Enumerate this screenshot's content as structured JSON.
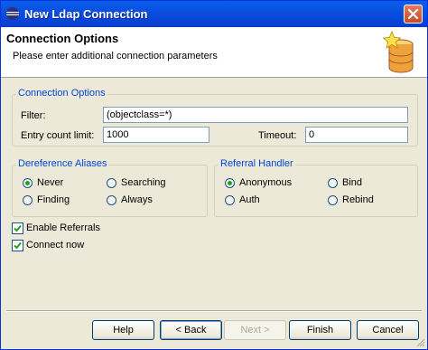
{
  "window": {
    "title": "New Ldap Connection"
  },
  "banner": {
    "title": "Connection Options",
    "description": "Please enter additional connection parameters"
  },
  "connection_options": {
    "legend": "Connection Options",
    "filter_label": "Filter:",
    "filter_value": "(objectclass=*)",
    "count_limit_label": "Entry count limit:",
    "count_limit_value": "1000",
    "timeout_label": "Timeout:",
    "timeout_value": "0"
  },
  "dereference": {
    "legend": "Dereference Aliases",
    "options": [
      "Never",
      "Searching",
      "Finding",
      "Always"
    ],
    "selected": "Never"
  },
  "referral": {
    "legend": "Referral Handler",
    "options": [
      "Anonymous",
      "Bind",
      "Auth",
      "Rebind"
    ],
    "selected": "Anonymous"
  },
  "checkboxes": {
    "enable_referrals": {
      "label": "Enable Referrals",
      "checked": true
    },
    "connect_now": {
      "label": "Connect now",
      "checked": true
    }
  },
  "buttons": {
    "help": "Help",
    "back": "< Back",
    "next": "Next >",
    "finish": "Finish",
    "cancel": "Cancel"
  },
  "colors": {
    "title_bar": "#0a4fe0",
    "group_legend": "#0046d5",
    "radio_selected": "#21a121",
    "checkbox_check": "#21a121"
  }
}
